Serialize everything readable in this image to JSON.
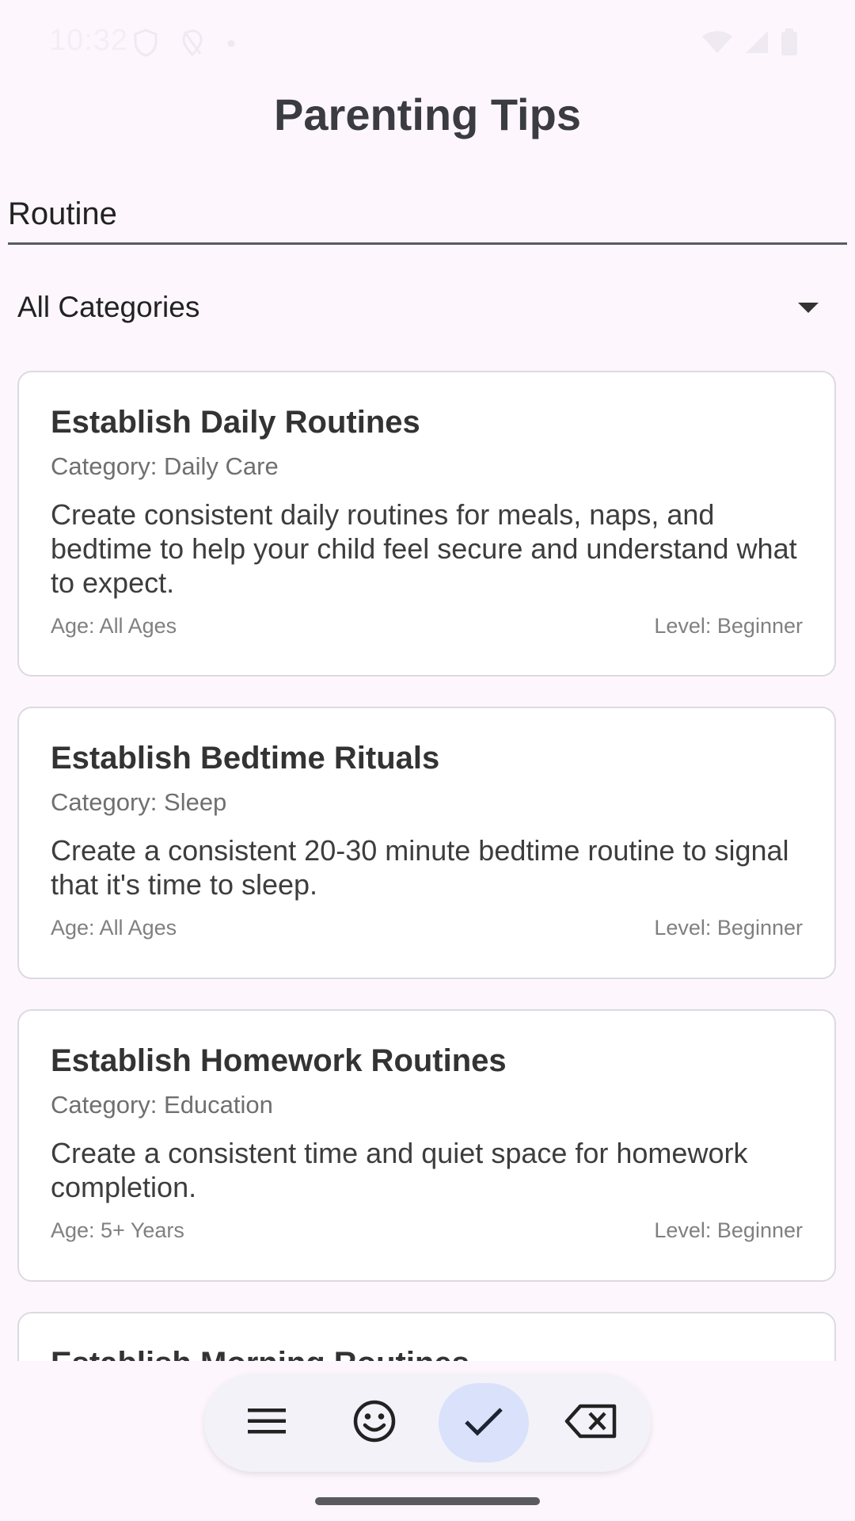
{
  "status_bar": {
    "time": "10:32",
    "left_icons": [
      "shield-icon",
      "location-off-icon",
      "dot-icon"
    ],
    "right_icons": [
      "wifi-icon",
      "cellular-signal-icon",
      "battery-icon"
    ]
  },
  "header": {
    "title": "Parenting Tips"
  },
  "search": {
    "value": "Routine",
    "placeholder": ""
  },
  "filter": {
    "selected": "All Categories"
  },
  "tips": [
    {
      "title": "Establish Daily Routines",
      "category": "Category: Daily Care",
      "description": "Create consistent daily routines for meals, naps, and bedtime to help your child feel secure and understand what to expect.",
      "age": "Age: All Ages",
      "level": "Level: Beginner"
    },
    {
      "title": "Establish Bedtime Rituals",
      "category": "Category: Sleep",
      "description": "Create a consistent 20-30 minute bedtime routine to signal that it's time to sleep.",
      "age": "Age: All Ages",
      "level": "Level: Beginner"
    },
    {
      "title": "Establish Homework Routines",
      "category": "Category: Education",
      "description": "Create a consistent time and quiet space for homework completion.",
      "age": "Age: 5+ Years",
      "level": "Level: Beginner"
    },
    {
      "title": "Establish Morning Routines"
    }
  ],
  "toolbar": {
    "buttons": [
      "menu-icon",
      "emoji-icon",
      "check-icon",
      "backspace-icon"
    ],
    "active": "check-icon"
  },
  "colors": {
    "background": "#fdf7fd",
    "card_border": "#dcdadf",
    "active_button": "#d9e2fa",
    "toolbar": "#f3f2f9"
  }
}
